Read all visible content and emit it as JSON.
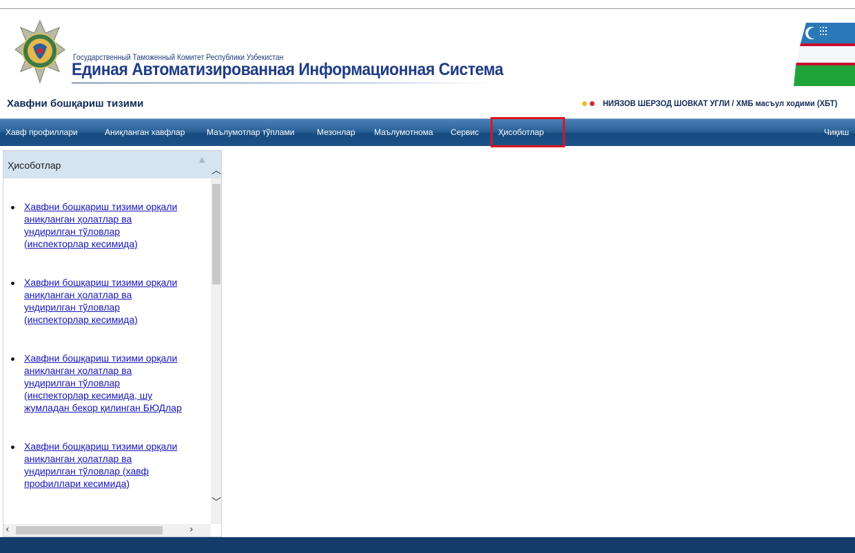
{
  "header": {
    "org_name": "Государственный Таможенный Комитет Республики Узбекистан",
    "system_name": "Единая Автоматизированная Информационная Система",
    "module_title": "Хавфни бошқариш тизими",
    "user_name": "НИЯЗОВ ШЕРЗОД ШОВКАТ УГЛИ / ХМБ масъул ходими (ХБТ)"
  },
  "nav": {
    "items": [
      {
        "label": "Хавф профиллари"
      },
      {
        "label": "Аниқланган хавфлар"
      },
      {
        "label": "Маълумотлар тўплами"
      },
      {
        "label": "Мезонлар"
      },
      {
        "label": "Маълумотнома"
      },
      {
        "label": "Сервис"
      },
      {
        "label": "Ҳисоботлар",
        "active": true
      },
      {
        "label": "Чиқиш"
      }
    ]
  },
  "side_panel": {
    "title": "Ҳисоботлар",
    "reports": [
      {
        "label": "Хавфни бошқариш тизими орқали\nаниқланган ҳолатлар ва\nундирилган тўловлар\n(инспекторлар кесимида)"
      },
      {
        "label": "Хавфни бошқариш тизими орқали\nаниқланган ҳолатлар ва\nундирилган тўловлар\n(инспекторлар кесимида)"
      },
      {
        "label": "Хавфни бошқариш тизими орқали\nаниқланган ҳолатлар ва\nундирилган тўловлар\n(инспекторлар кесимида, шу\nжумладан бекор қилинган БЮДлар"
      },
      {
        "label": "Хавфни бошқариш тизими орқали\nаниқланган ҳолатлар ва\nундирилган тўловлар (хавф\nпрофиллари кесимида)"
      }
    ]
  },
  "colors": {
    "nav_bar": "#1a5186",
    "highlight": "#e0141a",
    "link": "#1515b6",
    "footer": "#143c6b"
  }
}
